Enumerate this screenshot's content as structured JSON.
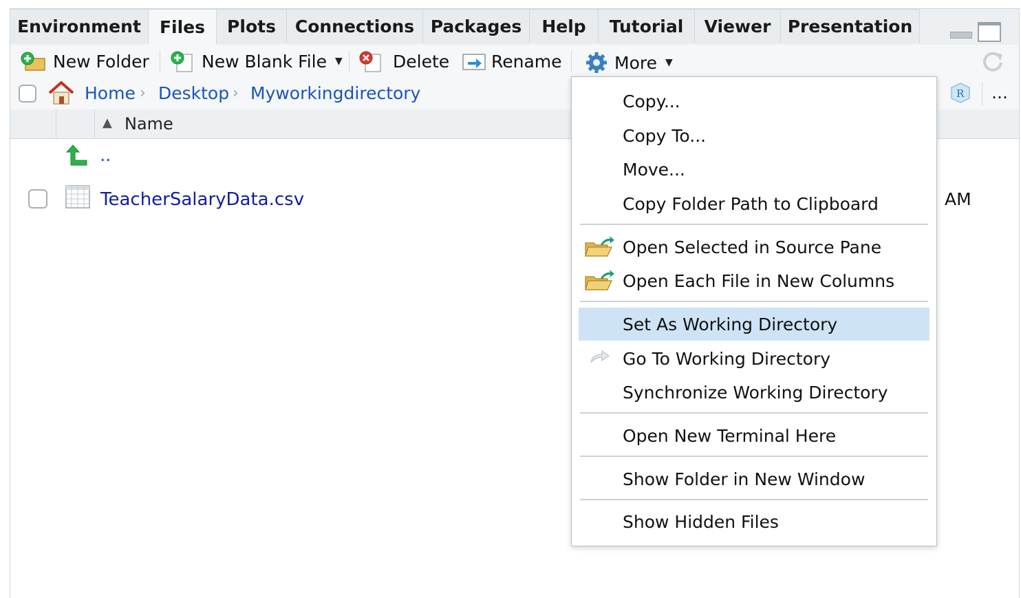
{
  "tabs": [
    "Environment",
    "Files",
    "Plots",
    "Connections",
    "Packages",
    "Help",
    "Tutorial",
    "Viewer",
    "Presentation"
  ],
  "active_tab": "Files",
  "toolbar": {
    "new_folder": "New Folder",
    "new_blank_file": "New Blank File",
    "delete": "Delete",
    "rename": "Rename",
    "more": "More"
  },
  "breadcrumb": [
    "Home",
    "Desktop",
    "Myworkingdirectory"
  ],
  "columns": {
    "name": "Name"
  },
  "files": {
    "parent": "..",
    "rows": [
      {
        "name": "TeacherSalaryData.csv",
        "modified_partial": "AM"
      }
    ]
  },
  "more_menu": {
    "items": [
      "Copy...",
      "Copy To...",
      "Move...",
      "Copy Folder Path to Clipboard",
      "Open Selected in Source Pane",
      "Open Each File in New Columns",
      "Set As Working Directory",
      "Go To Working Directory",
      "Synchronize Working Directory",
      "Open New Terminal Here",
      "Show Folder in New Window",
      "Show Hidden Files"
    ],
    "highlighted": "Set As Working Directory"
  },
  "colors": {
    "link": "#1a55b8",
    "file_link": "#0f1f9e",
    "highlight": "#cfe3f6",
    "tab_bg": "#e8ecef"
  },
  "icons": [
    "new-folder-icon",
    "new-file-icon",
    "delete-icon",
    "rename-icon",
    "gear-icon",
    "refresh-icon",
    "home-icon",
    "r-project-icon",
    "up-arrow-icon",
    "csv-file-icon",
    "open-folder-icon",
    "go-to-arrow-icon",
    "minimize-icon",
    "maximize-icon"
  ]
}
